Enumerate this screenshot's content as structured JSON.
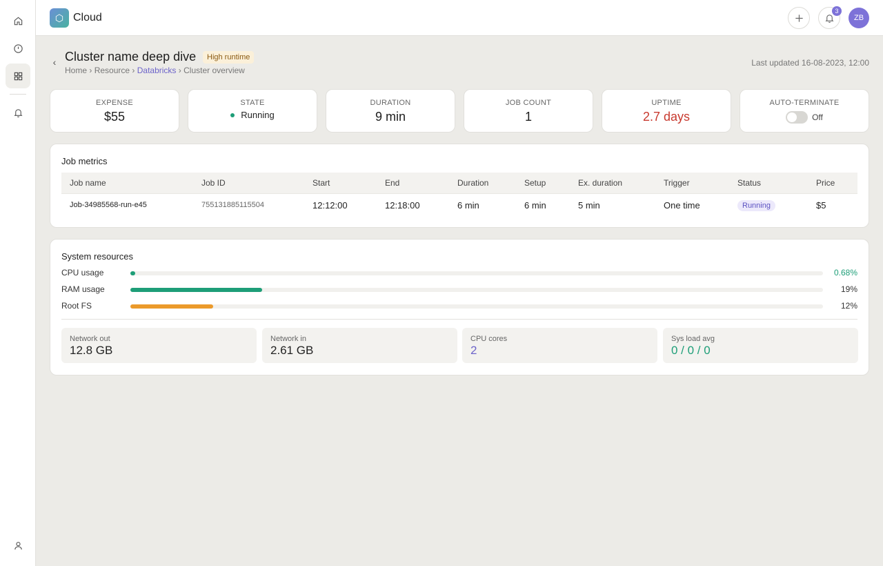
{
  "app": {
    "name": "Cloud",
    "logo_icon": "hexagon-icon"
  },
  "rail": {
    "items": [
      {
        "icon": "home-icon",
        "active": false
      },
      {
        "icon": "clock-icon",
        "active": false
      },
      {
        "icon": "grid-icon",
        "active": true
      },
      {
        "icon": "bell-icon",
        "active": false
      }
    ],
    "bottom_icon": "user-icon"
  },
  "topbar": {
    "add_icon": "plus-icon",
    "notification_icon": "bell-icon",
    "notification_count": "3",
    "avatar_initials": "ZB"
  },
  "header": {
    "title": "Cluster name deep dive",
    "badge": "High runtime",
    "breadcrumb": {
      "home": "Home",
      "resource": "Resource",
      "provider": "Databricks",
      "current": "Cluster overview",
      "separator": "›"
    },
    "last_updated": "Last updated 16-08-2023, 12:00"
  },
  "stats": {
    "expense": {
      "label": "EXPENSE",
      "value": "$55"
    },
    "state": {
      "label": "STATE",
      "value": "Running"
    },
    "duration": {
      "label": "DURATION",
      "value": "9 min"
    },
    "job_count": {
      "label": "JOB COUNT",
      "value": "1"
    },
    "uptime": {
      "label": "UPTIME",
      "value": "2.7 days"
    },
    "auto_terminate": {
      "label": "AUTO-TERMINATE",
      "value": "Off",
      "enabled": false
    }
  },
  "job_metrics": {
    "title": "Job metrics",
    "columns": [
      "Job name",
      "Job ID",
      "Start",
      "End",
      "Duration",
      "Setup",
      "Ex. duration",
      "Trigger",
      "Status",
      "Price"
    ],
    "rows": [
      {
        "job_name": "Job-34985568-run-e45",
        "job_id": "755131885115504",
        "start": "12:12:00",
        "end": "12:18:00",
        "duration": "6 min",
        "setup": "6 min",
        "ex_duration": "5 min",
        "trigger": "One time",
        "status": "Running",
        "price": "$5"
      }
    ]
  },
  "system_resources": {
    "title": "System resources",
    "bars": [
      {
        "label": "CPU usage",
        "value": "0.68%",
        "fraction": 0.0068,
        "color": "#1e9e78"
      },
      {
        "label": "RAM usage",
        "value": "19%",
        "fraction": 0.19,
        "color": "#1e9e78"
      },
      {
        "label": "Root FS",
        "value": "12%",
        "fraction": 0.12,
        "color": "#eb9a2b"
      }
    ],
    "cards": [
      {
        "label": "Network out",
        "value": "12.8 GB"
      },
      {
        "label": "Network in",
        "value": "2.61 GB"
      },
      {
        "label": "CPU cores",
        "value": "2"
      },
      {
        "label": "Sys load avg",
        "value": "0 / 0 / 0"
      }
    ]
  },
  "colors": {
    "accent": "#7d72d8",
    "success": "#1e9e78",
    "warning": "#eb9a2b",
    "danger": "#c8392e"
  }
}
